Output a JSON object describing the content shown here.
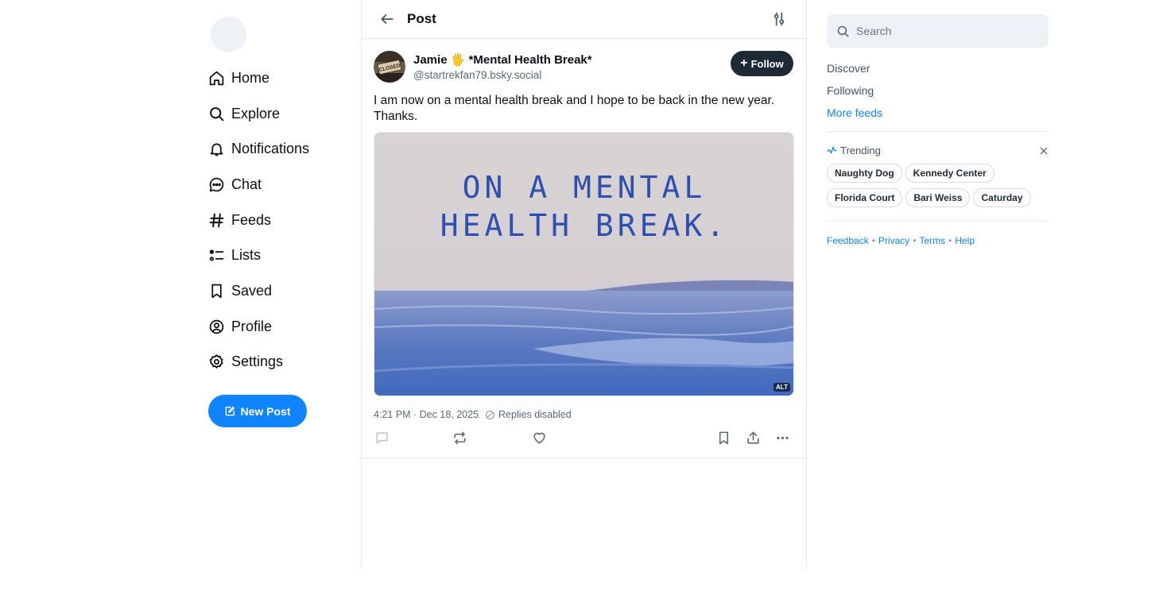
{
  "nav": {
    "items": [
      {
        "label": "Home",
        "icon": "home-icon"
      },
      {
        "label": "Explore",
        "icon": "search-icon"
      },
      {
        "label": "Notifications",
        "icon": "bell-icon"
      },
      {
        "label": "Chat",
        "icon": "chat-icon"
      },
      {
        "label": "Feeds",
        "icon": "hash-icon"
      },
      {
        "label": "Lists",
        "icon": "list-icon"
      },
      {
        "label": "Saved",
        "icon": "bookmark-icon"
      },
      {
        "label": "Profile",
        "icon": "profile-icon"
      },
      {
        "label": "Settings",
        "icon": "gear-icon"
      }
    ],
    "new_post_label": "New Post"
  },
  "header": {
    "title": "Post"
  },
  "post": {
    "author_name": "Jamie 🖐️ *Mental Health Break*",
    "author_handle": "@startrekfan79.bsky.social",
    "follow_label": "Follow",
    "text": "I am now on a mental health break and I hope to be back in the new year. Thanks.",
    "image_text_line1": "ON A MENTAL",
    "image_text_line2": "HEALTH BREAK.",
    "alt_badge": "ALT",
    "avatar_sign_text": "CLOSED",
    "timestamp": "4:21 PM · Dec 18, 2025",
    "replies_status": "Replies disabled"
  },
  "sidebar": {
    "search_placeholder": "Search",
    "feeds": [
      "Discover",
      "Following",
      "More feeds"
    ],
    "trending_title": "Trending",
    "trending_topics": [
      "Naughty Dog",
      "Kennedy Center",
      "Florida Court",
      "Bari Weiss",
      "Caturday"
    ],
    "footer_links": [
      "Feedback",
      "Privacy",
      "Terms",
      "Help"
    ]
  },
  "colors": {
    "accent": "#1083fe",
    "follow_bg": "#1e2936",
    "border": "#e6e9ee",
    "muted_text": "#5b6875"
  }
}
